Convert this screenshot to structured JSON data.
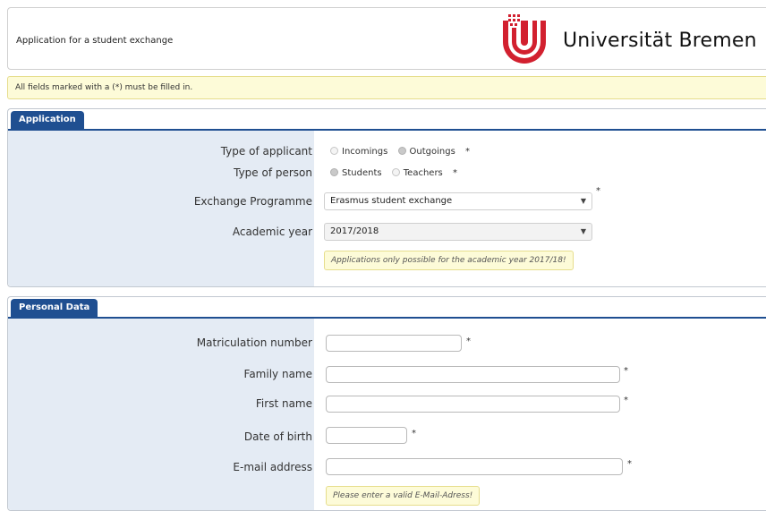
{
  "header": {
    "title": "Application for a student exchange",
    "logo_text": "Universität Bremen"
  },
  "notice": "All fields marked with a (*) must be filled in.",
  "application": {
    "tab": "Application",
    "type_of_applicant": {
      "label": "Type of applicant",
      "options": [
        "Incomings",
        "Outgoings"
      ],
      "selected": "Outgoings",
      "required": "*"
    },
    "type_of_person": {
      "label": "Type of person",
      "options": [
        "Students",
        "Teachers"
      ],
      "selected": "Students",
      "required": "*"
    },
    "exchange_programme": {
      "label": "Exchange Programme",
      "value": "Erasmus student exchange",
      "required": "*"
    },
    "academic_year": {
      "label": "Academic year",
      "value": "2017/2018",
      "hint": "Applications only possible for the academic year 2017/18!"
    }
  },
  "personal": {
    "tab": "Personal Data",
    "matriculation": {
      "label": "Matriculation number",
      "value": "",
      "required": "*"
    },
    "family_name": {
      "label": "Family name",
      "value": "",
      "required": "*"
    },
    "first_name": {
      "label": "First name",
      "value": "",
      "required": "*"
    },
    "date_of_birth": {
      "label": "Date of birth",
      "value": "",
      "required": "*"
    },
    "email": {
      "label": "E-mail address",
      "value": "",
      "required": "*",
      "hint": "Please enter a valid E-Mail-Adress!"
    }
  },
  "colors": {
    "tab_blue": "#1f4f91",
    "label_column": "#e4ebf4",
    "notice_bg": "#fdfbd8",
    "logo_red": "#d2202f"
  }
}
